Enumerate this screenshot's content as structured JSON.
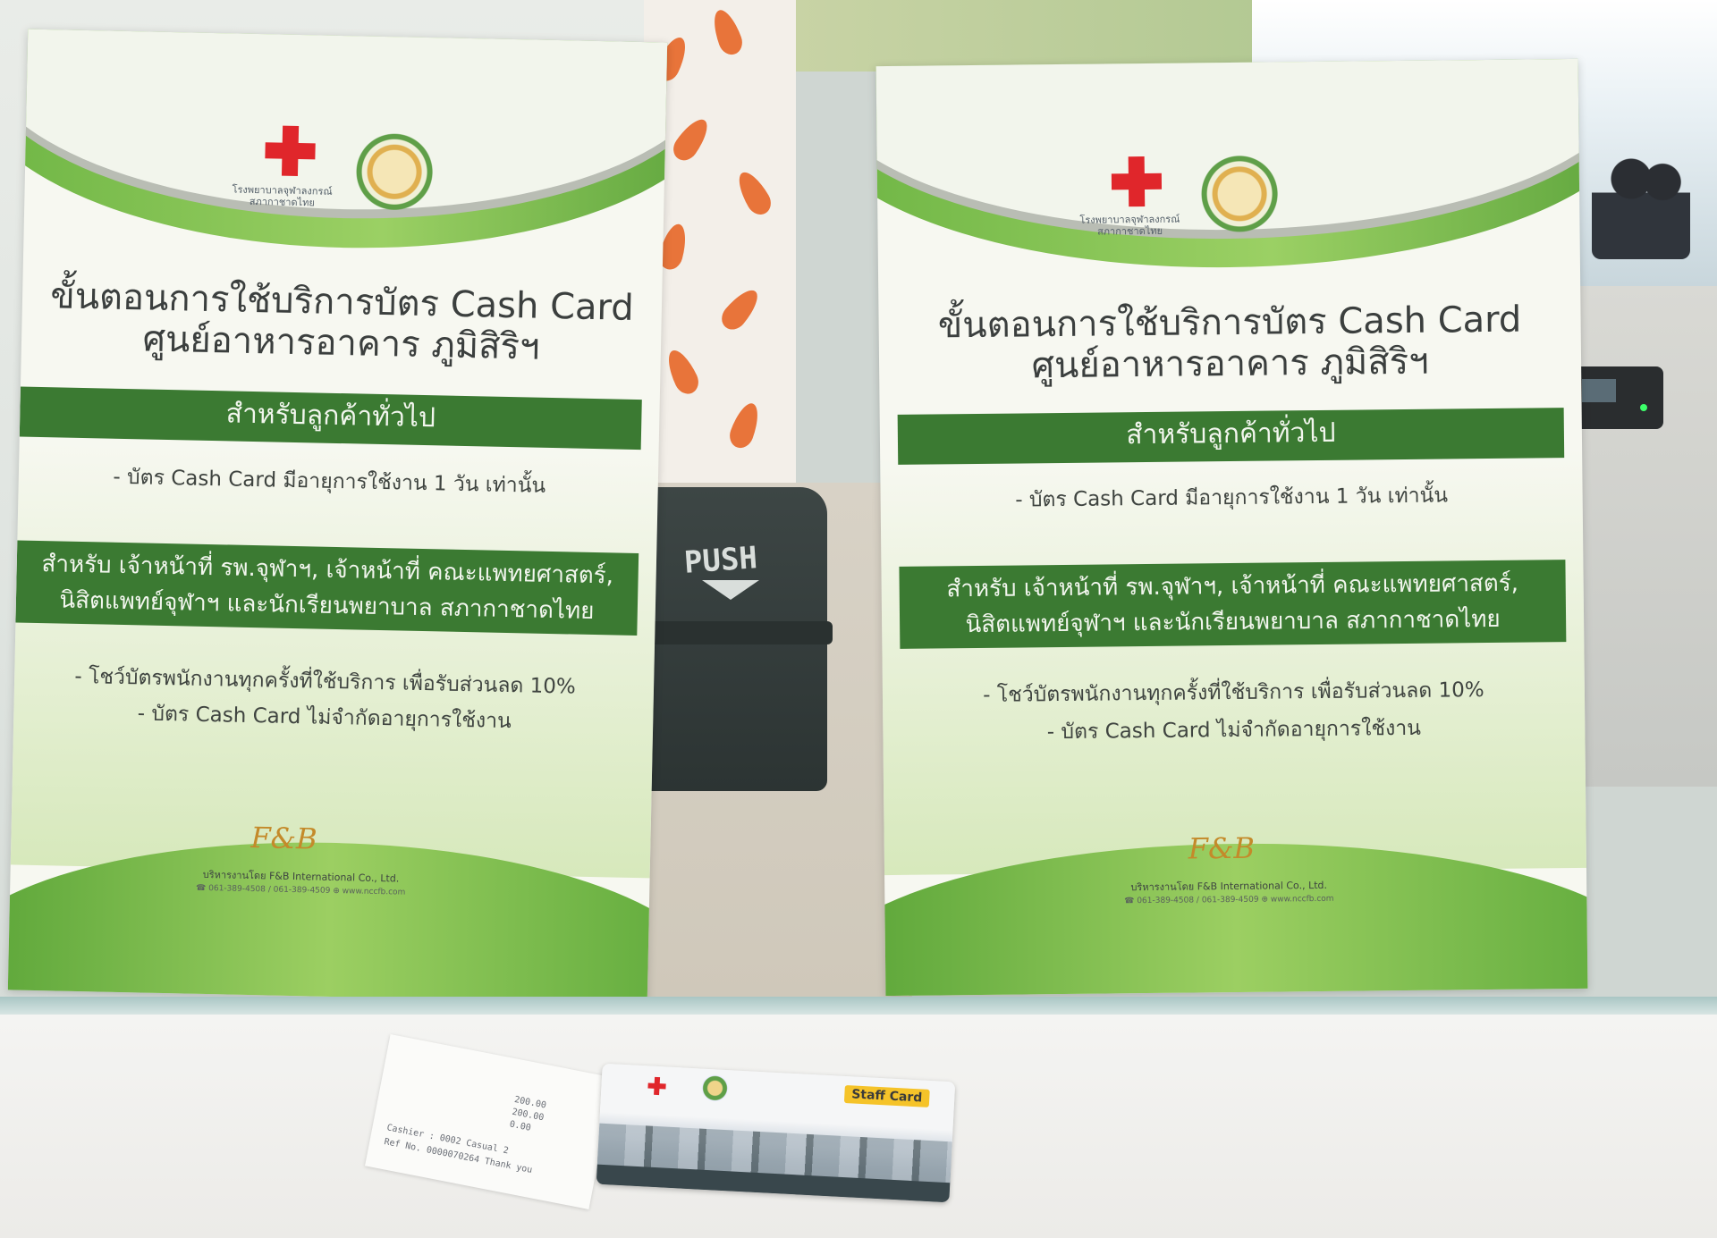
{
  "posters": [
    {
      "logo_caption_1": "โรงพยาบาลจุฬาลงกรณ์",
      "logo_caption_2": "สภากาชาดไทย",
      "title_line1": "ขั้นตอนการใช้บริการบัตร Cash Card",
      "title_line2": "ศูนย์อาหารอาคาร ภูมิสิริฯ",
      "band1": "สำหรับลูกค้าทั่วไป",
      "band1_bullet": "- บัตร Cash Card มีอายุการใช้งาน 1 วัน เท่านั้น",
      "band2_line1": "สำหรับ เจ้าหน้าที่ รพ.จุฬาฯ, เจ้าหน้าที่ คณะแพทยศาสตร์,",
      "band2_line2": "นิสิตแพทย์จุฬาฯ และนักเรียนพยาบาล สภากาชาดไทย",
      "band2_bullet1": "- โชว์บัตรพนักงานทุกครั้งที่ใช้บริการ เพื่อรับส่วนลด 10%",
      "band2_bullet2": "- บัตร Cash Card ไม่จำกัดอายุการใช้งาน",
      "company": "บริหารงานโดย F&B International Co., Ltd.",
      "phones": "061-389-4508 / 061-389-4509",
      "website": "www.nccfb.com"
    },
    {
      "logo_caption_1": "โรงพยาบาลจุฬาลงกรณ์",
      "logo_caption_2": "สภากาชาดไทย",
      "title_line1": "ขั้นตอนการใช้บริการบัตร Cash Card",
      "title_line2": "ศูนย์อาหารอาคาร ภูมิสิริฯ",
      "band1": "สำหรับลูกค้าทั่วไป",
      "band1_bullet": "- บัตร Cash Card มีอายุการใช้งาน 1 วัน เท่านั้น",
      "band2_line1": "สำหรับ เจ้าหน้าที่ รพ.จุฬาฯ, เจ้าหน้าที่ คณะแพทยศาสตร์,",
      "band2_line2": "นิสิตแพทย์จุฬาฯ และนักเรียนพยาบาล สภากาชาดไทย",
      "band2_bullet1": "- โชว์บัตรพนักงานทุกครั้งที่ใช้บริการ เพื่อรับส่วนลด 10%",
      "band2_bullet2": "- บัตร Cash Card ไม่จำกัดอายุการใช้งาน",
      "company": "บริหารงานโดย F&B International Co., Ltd.",
      "phones": "061-389-4508 / 061-389-4509",
      "website": "www.nccfb.com"
    }
  ],
  "bin": {
    "label": "PUSH"
  },
  "fb_logo": "F&B",
  "receipt": {
    "line_amount_1": "200.00",
    "line_amount_2": "200.00",
    "line_amount_3": "0.00",
    "cashier": "Cashier : 0002 Casual 2",
    "ref": "Ref No. 0000070264 Thank you"
  },
  "card": {
    "badge": "Staff Card"
  },
  "colors": {
    "poster_green": "#3b7a32",
    "accent_green": "#6cb443",
    "red_cross": "#e0262b",
    "badge_yellow": "#f5c329"
  }
}
